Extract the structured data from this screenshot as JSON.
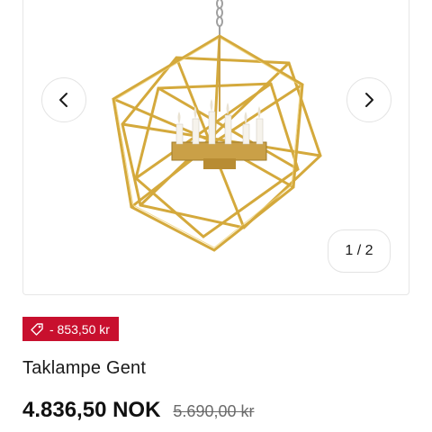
{
  "gallery": {
    "image_alt": "Taklampe Gent",
    "prev_icon": "chevron-left-icon",
    "next_icon": "chevron-right-icon",
    "counter": "1 / 2"
  },
  "product": {
    "discount_icon": "tag-icon",
    "discount_label": "- 853,50 kr",
    "title": "Taklampe Gent",
    "price": "4.836,50 NOK",
    "original_price": "5.690,00 kr"
  },
  "colors": {
    "discount_bg": "#c8102e",
    "lamp_gold": "#d4a93c"
  }
}
